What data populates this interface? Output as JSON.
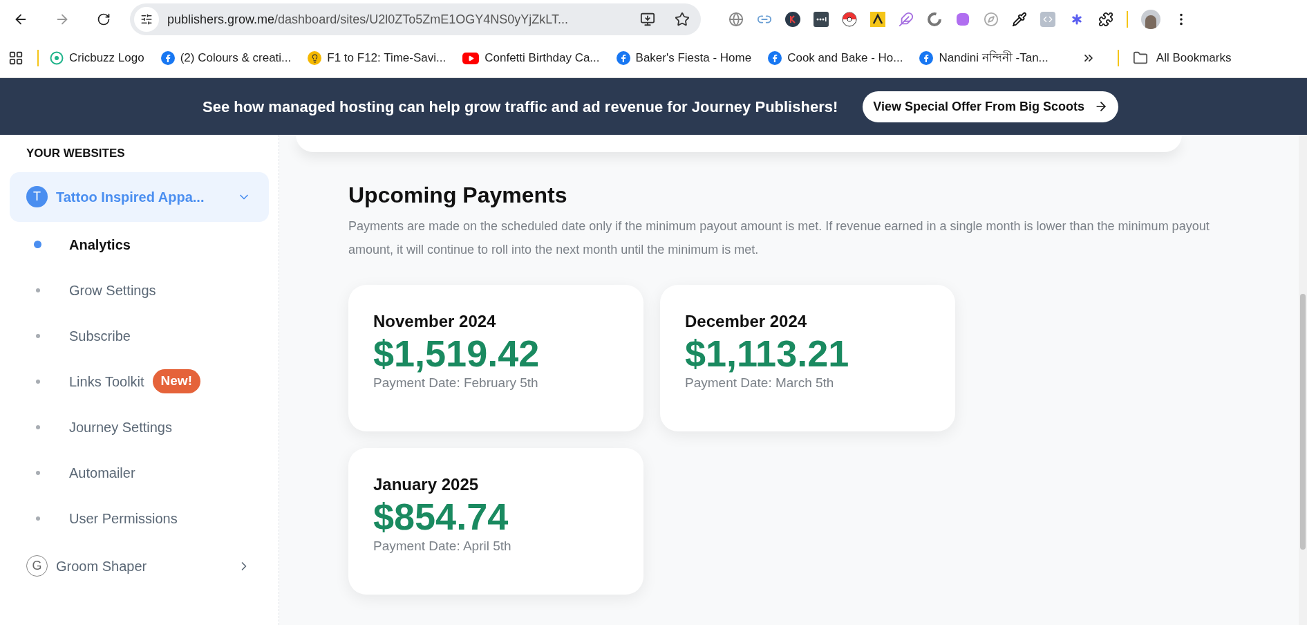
{
  "browser": {
    "url_host": "publishers.grow.me",
    "url_path": "/dashboard/sites/U2l0ZTo5ZmE1OGY4NS0yYjZkLT...",
    "bookmarks": [
      {
        "label": "Cricbuzz Logo",
        "kind": "cricbuzz"
      },
      {
        "label": "(2) Colours & creati...",
        "kind": "facebook"
      },
      {
        "label": "F1 to F12: Time-Savi...",
        "kind": "bulb"
      },
      {
        "label": "Confetti Birthday Ca...",
        "kind": "youtube"
      },
      {
        "label": "Baker's Fiesta - Home",
        "kind": "facebook"
      },
      {
        "label": "Cook and Bake - Ho...",
        "kind": "facebook"
      },
      {
        "label": "Nandini নন্দিনী -Tan...",
        "kind": "facebook"
      }
    ],
    "all_bookmarks": "All Bookmarks"
  },
  "banner": {
    "text": "See how managed hosting can help grow traffic and ad revenue for Journey Publishers!",
    "button": "View Special Offer From Big Scoots"
  },
  "sidebar": {
    "heading": "YOUR WEBSITES",
    "sites": [
      {
        "initial": "T",
        "name": "Tattoo Inspired Appa...",
        "expanded": true,
        "items": [
          {
            "label": "Analytics",
            "selected": true
          },
          {
            "label": "Grow Settings",
            "selected": false
          },
          {
            "label": "Subscribe",
            "selected": false
          },
          {
            "label": "Links Toolkit",
            "selected": false,
            "badge": "New!"
          },
          {
            "label": "Journey Settings",
            "selected": false
          },
          {
            "label": "Automailer",
            "selected": false
          },
          {
            "label": "User Permissions",
            "selected": false
          }
        ]
      },
      {
        "initial": "G",
        "name": "Groom Shaper",
        "expanded": false
      }
    ]
  },
  "payments": {
    "title": "Upcoming Payments",
    "description": "Payments are made on the scheduled date only if the minimum payout amount is met. If revenue earned in a single month is lower than the minimum payout amount, it will continue to roll into the next month until the minimum is met.",
    "cards": [
      {
        "month": "November 2024",
        "amount": "$1,519.42",
        "date": "Payment Date: February 5th"
      },
      {
        "month": "December 2024",
        "amount": "$1,113.21",
        "date": "Payment Date: March 5th"
      },
      {
        "month": "January 2025",
        "amount": "$854.74",
        "date": "Payment Date: April 5th"
      }
    ]
  }
}
